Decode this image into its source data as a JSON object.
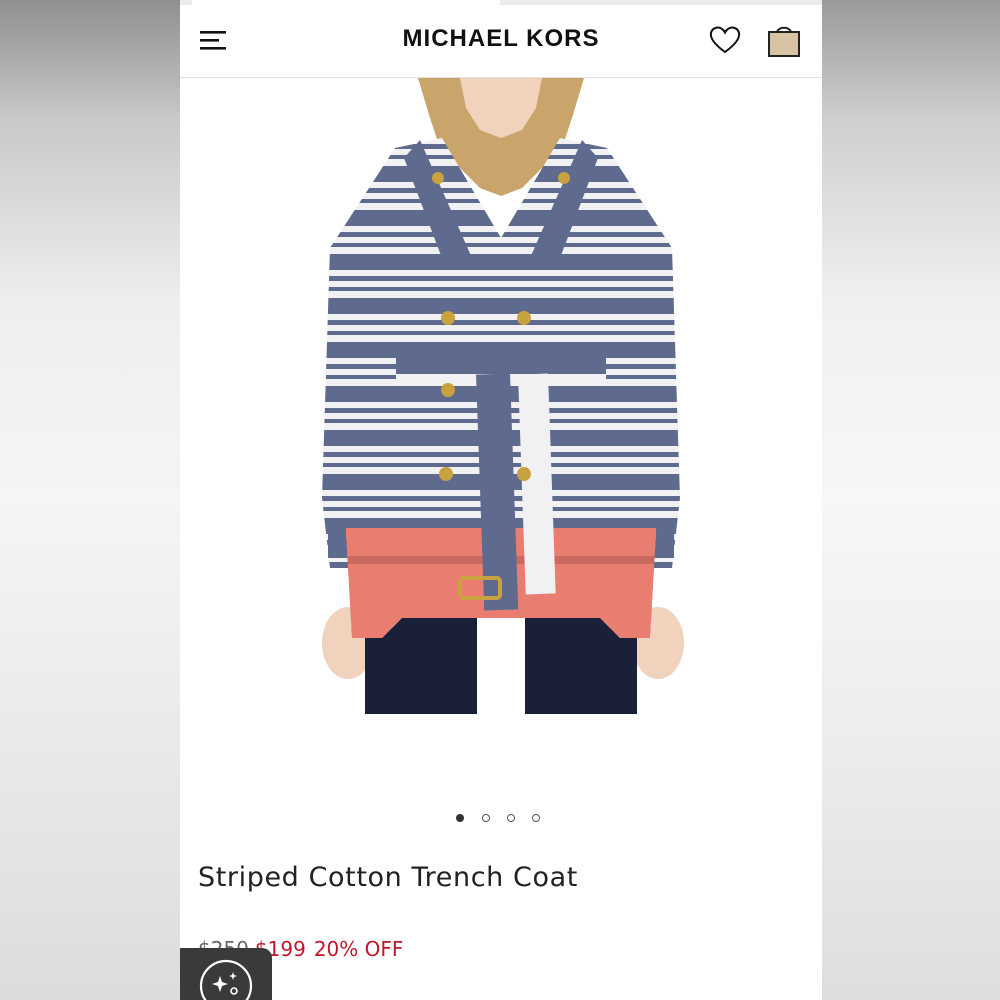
{
  "header": {
    "brand": "MICHAEL KORS",
    "menu_icon": "hamburger-menu-icon",
    "wishlist_icon": "heart-icon",
    "bag_icon": "shopping-bag-icon"
  },
  "product": {
    "image_alt": "Striped Cotton Trench Coat product photo",
    "title": "Striped Cotton Trench Coat",
    "original_price": "$250",
    "sale_price": "$199",
    "discount": "20% OFF"
  },
  "carousel": {
    "total": 4,
    "active_index": 0
  },
  "colors": {
    "brand_text": "#111111",
    "sale_red": "#c0182a",
    "stripe_blue": "#5e6b8f",
    "stripe_white": "#f2f2f4",
    "coral": "#e87d70",
    "bag_tan": "#d9c3a5"
  },
  "floating_button": {
    "icon": "sparkle-icon"
  }
}
